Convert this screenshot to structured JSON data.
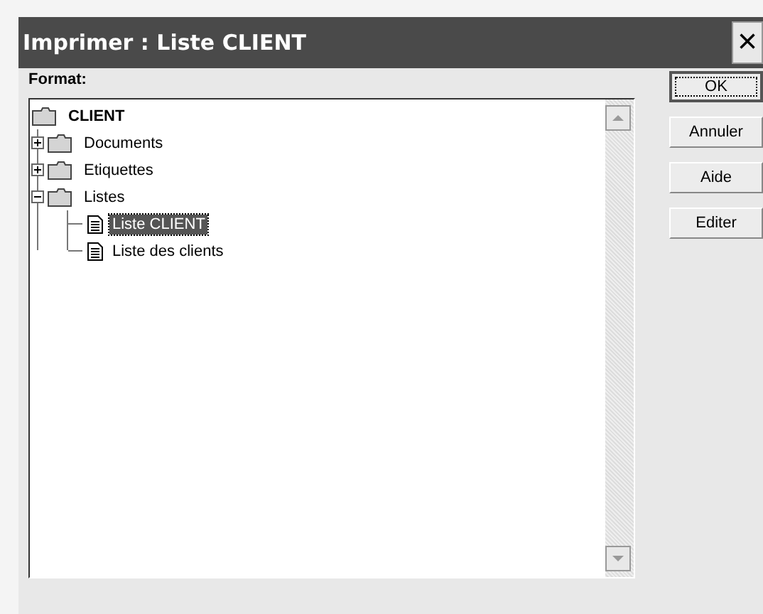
{
  "window": {
    "title": "Imprimer : Liste CLIENT",
    "close": "×"
  },
  "format_label": "Format:",
  "tree": [
    {
      "label": "CLIENT",
      "kind": "folder",
      "expanded": true,
      "root": true,
      "selected": false,
      "children": [
        {
          "label": "Documents",
          "kind": "folder",
          "expanded": false,
          "selected": false
        },
        {
          "label": "Etiquettes",
          "kind": "folder",
          "expanded": false,
          "selected": false
        },
        {
          "label": "Listes",
          "kind": "folder",
          "expanded": true,
          "selected": false,
          "children": [
            {
              "label": "Liste CLIENT",
              "kind": "document",
              "selected": true
            },
            {
              "label": "Liste des clients",
              "kind": "document",
              "selected": false
            }
          ]
        }
      ]
    }
  ],
  "buttons": [
    {
      "label": "OK",
      "default": true
    },
    {
      "label": "Annuler",
      "default": false
    },
    {
      "label": "Aide",
      "default": false
    },
    {
      "label": "Editer",
      "default": false
    }
  ]
}
